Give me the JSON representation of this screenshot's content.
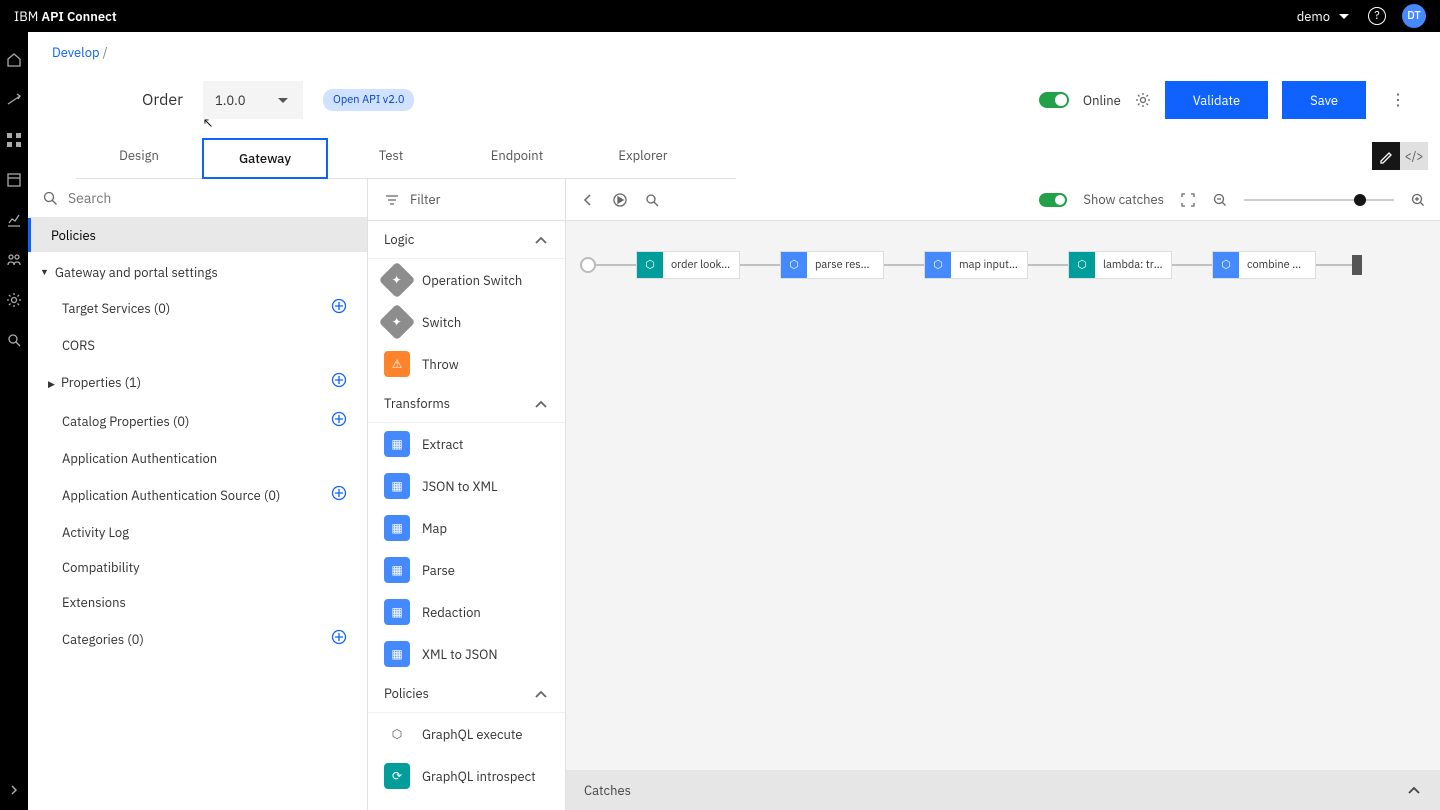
{
  "header": {
    "brand_prefix": "IBM ",
    "brand_name": "API Connect",
    "user": "demo",
    "avatar_initials": "DT"
  },
  "breadcrumb": {
    "link": "Develop",
    "sep": "/"
  },
  "page": {
    "api_name": "Order",
    "version": "1.0.0",
    "badge": "Open API v2.0",
    "online_label": "Online",
    "validate": "Validate",
    "save": "Save"
  },
  "tabs": [
    "Design",
    "Gateway",
    "Test",
    "Endpoint",
    "Explorer"
  ],
  "active_tab": "Gateway",
  "search_placeholder": "Search",
  "sidepanel": {
    "policies_label": "Policies",
    "group_header": "Gateway and portal settings",
    "items": [
      {
        "label": "Target Services (0)",
        "add": true
      },
      {
        "label": "CORS",
        "add": false
      },
      {
        "label": "Properties (1)",
        "add": true,
        "caret": true
      },
      {
        "label": "Catalog Properties (0)",
        "add": true
      },
      {
        "label": "Application Authentication",
        "add": false
      },
      {
        "label": "Application Authentication Source (0)",
        "add": true
      },
      {
        "label": "Activity Log",
        "add": false
      },
      {
        "label": "Compatibility",
        "add": false
      },
      {
        "label": "Extensions",
        "add": false
      },
      {
        "label": "Categories (0)",
        "add": true
      }
    ]
  },
  "palette": {
    "filter": "Filter",
    "groups": [
      {
        "name": "Logic",
        "items": [
          {
            "label": "Operation Switch",
            "ic": "gray"
          },
          {
            "label": "Switch",
            "ic": "gray"
          },
          {
            "label": "Throw",
            "ic": "orange"
          }
        ]
      },
      {
        "name": "Transforms",
        "items": [
          {
            "label": "Extract",
            "ic": "blue"
          },
          {
            "label": "JSON to XML",
            "ic": "blue"
          },
          {
            "label": "Map",
            "ic": "blue"
          },
          {
            "label": "Parse",
            "ic": "blue"
          },
          {
            "label": "Redaction",
            "ic": "blue"
          },
          {
            "label": "XML to JSON",
            "ic": "blue"
          }
        ]
      },
      {
        "name": "Policies",
        "items": [
          {
            "label": "GraphQL execute",
            "ic": "none"
          },
          {
            "label": "GraphQL introspect",
            "ic": "teal"
          }
        ]
      }
    ]
  },
  "canvas": {
    "show_catches": "Show catches",
    "nodes": [
      {
        "label": "order lookup",
        "color": "#009d9a"
      },
      {
        "label": "parse response",
        "color": "#4589ff"
      },
      {
        "label": "map input to lam...",
        "color": "#4589ff"
      },
      {
        "label": "lambda: track sh...",
        "color": "#009d9a"
      },
      {
        "label": "combine data for...",
        "color": "#4589ff"
      }
    ],
    "catches_label": "Catches"
  }
}
